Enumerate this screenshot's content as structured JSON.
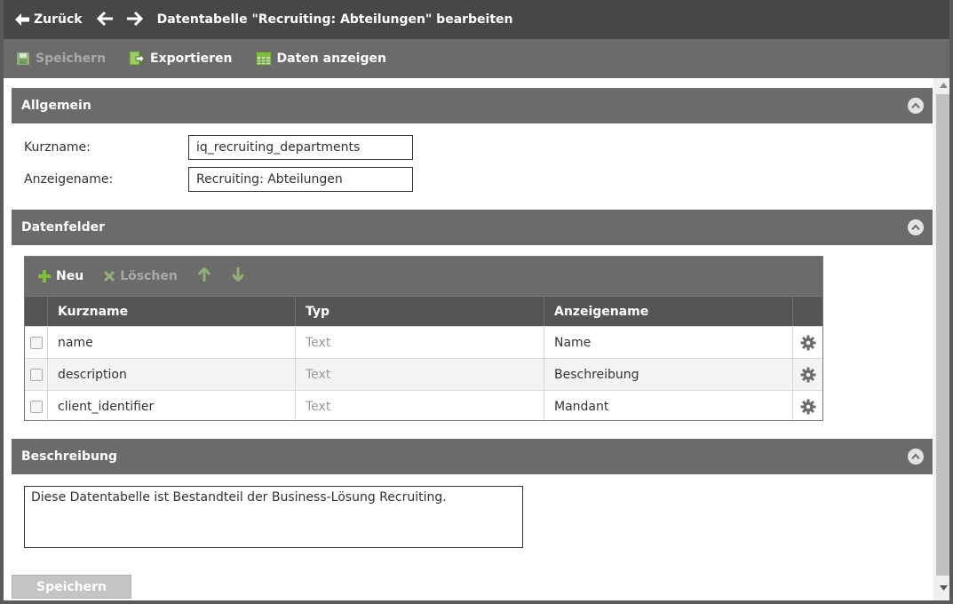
{
  "topbar": {
    "back_label": "Zurück",
    "title": "Datentabelle \"Recruiting: Abteilungen\" bearbeiten"
  },
  "toolbar": {
    "save_label": "Speichern",
    "export_label": "Exportieren",
    "show_data_label": "Daten anzeigen"
  },
  "sections": {
    "general": {
      "title": "Allgemein"
    },
    "fields": {
      "title": "Datenfelder"
    },
    "description": {
      "title": "Beschreibung"
    }
  },
  "general": {
    "shortname_label": "Kurzname:",
    "shortname_value": "iq_recruiting_departments",
    "displayname_label": "Anzeigename:",
    "displayname_value": "Recruiting: Abteilungen"
  },
  "grid": {
    "new_label": "Neu",
    "delete_label": "Löschen",
    "columns": [
      "Kurzname",
      "Typ",
      "Anzeigename"
    ],
    "rows": [
      {
        "name": "name",
        "type": "Text",
        "display": "Name"
      },
      {
        "name": "description",
        "type": "Text",
        "display": "Beschreibung"
      },
      {
        "name": "client_identifier",
        "type": "Text",
        "display": "Mandant"
      }
    ]
  },
  "description": {
    "text": "Diese Datentabelle ist Bestandteil der Business-Lösung Recruiting."
  },
  "footer": {
    "save_label": "Speichern"
  },
  "colors": {
    "topbar": "#474747",
    "toolbar": "#6b6b6b",
    "accent_green": "#7cbf3a"
  }
}
